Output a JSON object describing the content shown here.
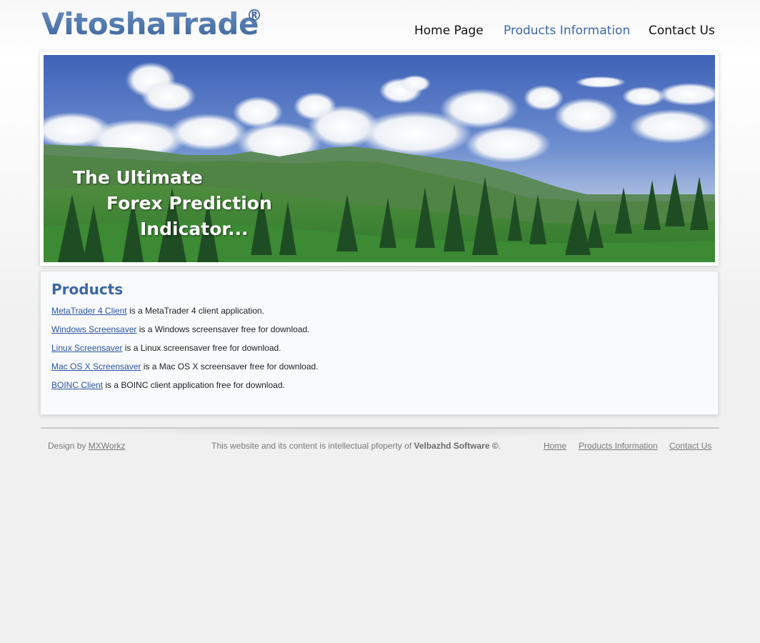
{
  "header": {
    "logo": "VitoshaTrade",
    "logo_mark": "®",
    "nav": [
      {
        "label": "Home Page"
      },
      {
        "label": "Products Information"
      },
      {
        "label": "Contact Us"
      }
    ]
  },
  "banner": {
    "lines": [
      "The Ultimate",
      "Forex Prediction",
      "Indicator..."
    ]
  },
  "content": {
    "title": "Products",
    "items": [
      {
        "link": "MetaTrader 4 Client",
        "text": " is a MetaTrader 4 client application."
      },
      {
        "link": "Windows Screensaver",
        "text": " is a Windows screensaver free for download."
      },
      {
        "link": "Linux Screensaver",
        "text": " is a Linux screensaver free for download."
      },
      {
        "link": "Mac OS X Screensaver",
        "text": " is a Mac OS X screensaver free for download."
      },
      {
        "link": "BOINC Client",
        "text": " is a BOINC client application free for download."
      }
    ]
  },
  "footer": {
    "design_prefix": "Design by ",
    "design_link": "MXWorkz",
    "copyright_prefix": "This website and its content is intellectual pfoperty of ",
    "copyright_owner": "Velbazhd Software ©",
    "copyright_suffix": ".",
    "links": [
      "Home",
      "Products Information",
      "Contact Us"
    ]
  },
  "colors": {
    "brand_blue": "#3b67a3",
    "link_blue": "#2a55a3",
    "page_bg": "#f0f0f0"
  }
}
